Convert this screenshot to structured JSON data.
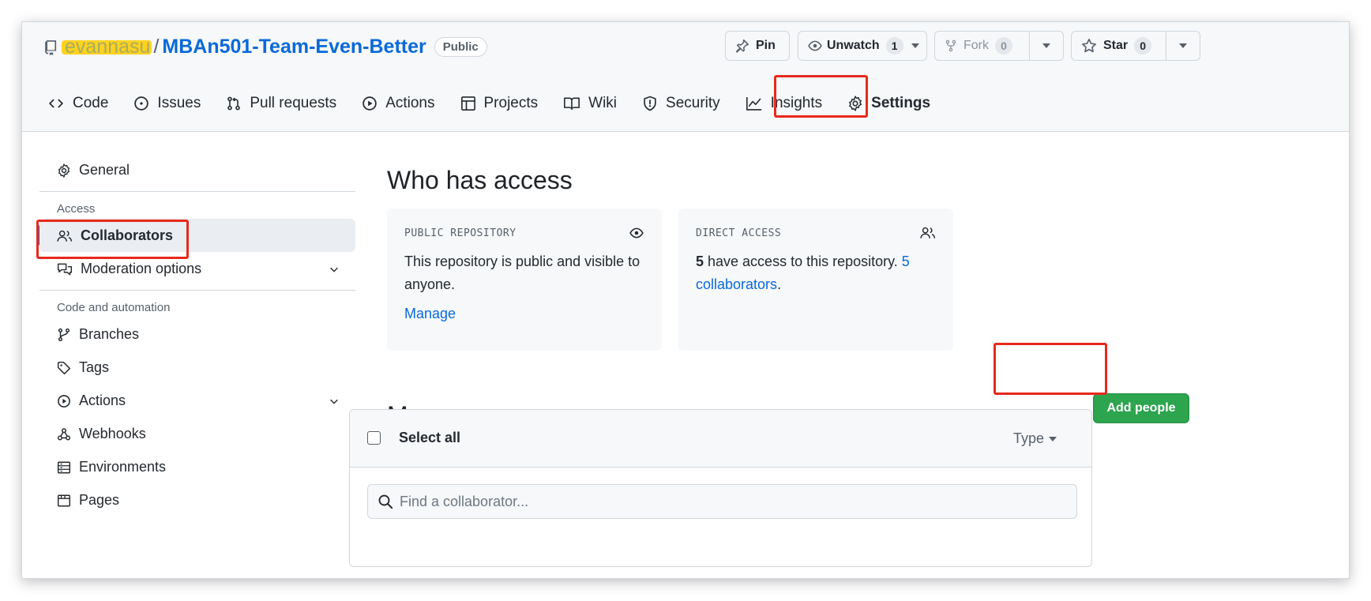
{
  "repo": {
    "owner": "evannasu",
    "separator": "/",
    "name": "MBAn501-Team-Even-Better",
    "visibility_badge": "Public"
  },
  "repo_actions": {
    "pin_label": "Pin",
    "unwatch_label": "Unwatch",
    "unwatch_count": "1",
    "fork_label": "Fork",
    "fork_count": "0",
    "star_label": "Star",
    "star_count": "0"
  },
  "tabs": [
    {
      "label": "Code",
      "icon": "code-icon"
    },
    {
      "label": "Issues",
      "icon": "issue-icon"
    },
    {
      "label": "Pull requests",
      "icon": "pull-request-icon"
    },
    {
      "label": "Actions",
      "icon": "play-icon"
    },
    {
      "label": "Projects",
      "icon": "table-icon"
    },
    {
      "label": "Wiki",
      "icon": "book-icon"
    },
    {
      "label": "Security",
      "icon": "shield-icon"
    },
    {
      "label": "Insights",
      "icon": "graph-icon"
    },
    {
      "label": "Settings",
      "icon": "gear-icon",
      "active": true
    }
  ],
  "sidebar": {
    "general": "General",
    "access_heading": "Access",
    "collaborators": "Collaborators",
    "moderation": "Moderation options",
    "code_heading": "Code and automation",
    "branches": "Branches",
    "tags": "Tags",
    "actions": "Actions",
    "webhooks": "Webhooks",
    "environments": "Environments",
    "pages": "Pages"
  },
  "who_has_access": {
    "heading": "Who has access",
    "public_card": {
      "title": "PUBLIC REPOSITORY",
      "text": "This repository is public and visible to anyone.",
      "manage_link": "Manage"
    },
    "direct_card": {
      "title": "DIRECT ACCESS",
      "count": "5",
      "text": " have access to this repository. ",
      "link": "5 collaborators",
      "period": "."
    }
  },
  "manage_access": {
    "heading": "Manage access",
    "add_button": "Add people",
    "select_all": "Select all",
    "type_filter": "Type",
    "search_placeholder": "Find a collaborator..."
  },
  "colors": {
    "accent": "#0969da",
    "primary_button": "#2da44e",
    "highlight_box": "#e8291c"
  }
}
